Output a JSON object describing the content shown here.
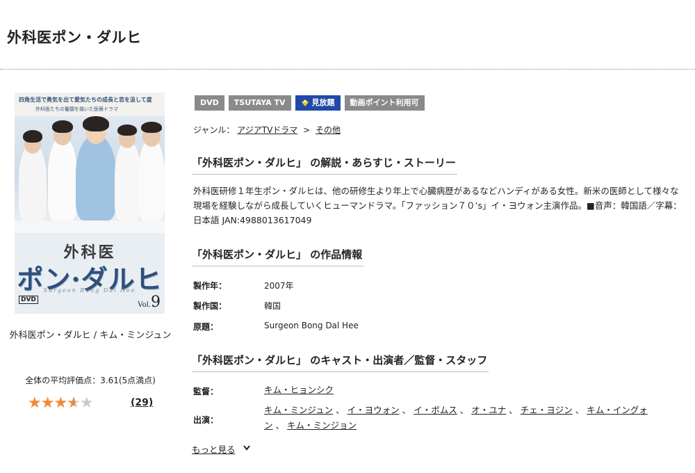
{
  "page": {
    "title": "外科医ポン・ダルヒ"
  },
  "cover": {
    "tagline": "四角生活で勇気を出て愛気たちの成長と恋を汲して度",
    "tagline2": "外科医たちの奮闘を描いた医療ドラマ",
    "title_small": "外科医",
    "title_big": "ポン·ダルヒ",
    "title_eng": "Surgeon Bong Dal Hee",
    "dvd_mark": "DVD",
    "vol_prefix": "Vol.",
    "vol_number": "9"
  },
  "caption": "外科医ポン・ダルヒ / キム・ミンジュン",
  "rating": {
    "label": "全体の平均評価点：3.61(5点満点)",
    "value": 3.61,
    "max": 5,
    "count": "(29)",
    "colors": {
      "filled": "#f08a3a",
      "empty": "#c9c9c9"
    }
  },
  "badges": [
    {
      "label": "DVD",
      "color": "#8a8a8a"
    },
    {
      "label": "TSUTAYA TV",
      "color": "#8a8a8a"
    },
    {
      "label": "見放題",
      "color": "#1f4aa8",
      "icon": "diamond-icon"
    },
    {
      "label": "動画ポイント利用可",
      "color": "#8a8a8a"
    }
  ],
  "genre": {
    "prefix": "ジャンル：",
    "items": [
      "アジアTVドラマ",
      "その他"
    ],
    "separator": ">"
  },
  "sections": {
    "synopsis_heading": "「外科医ポン・ダルヒ」 の解説・あらすじ・ストーリー",
    "synopsis_text": "外科医研修１年生ポン・ダルヒは、他の研修生より年上で心臓病歴があるなどハンディがある女性。新米の医師として様々な現場を経験しながら成長していくヒューマンドラマ。「ファッション７０’s」イ・ヨウォン主演作品。■音声：韓国語／字幕：日本語 JAN:4988013617049",
    "info_heading": "「外科医ポン・ダルヒ」 の作品情報",
    "cast_heading": "「外科医ポン・ダルヒ」 のキャスト・出演者／監督・スタッフ"
  },
  "info": [
    {
      "label": "製作年：",
      "value": "2007年"
    },
    {
      "label": "製作国：",
      "value": "韓国"
    },
    {
      "label": "原題：",
      "value": "Surgeon Bong Dal Hee"
    }
  ],
  "staff": {
    "director_label": "監督：",
    "directors": [
      "キム・ヒョンシク"
    ],
    "cast_label": "出演：",
    "cast_line1": [
      "キム・ミンジュン",
      "イ・ヨウォン",
      "イ・ボムス",
      "オ・ユナ",
      "チェ・ヨジン",
      "キム・イングォ"
    ],
    "cast_line2_lead": "ン",
    "cast_line2": [
      "キム・ミンジョン"
    ],
    "comma": "、"
  },
  "more": {
    "label": "もっと見る"
  }
}
